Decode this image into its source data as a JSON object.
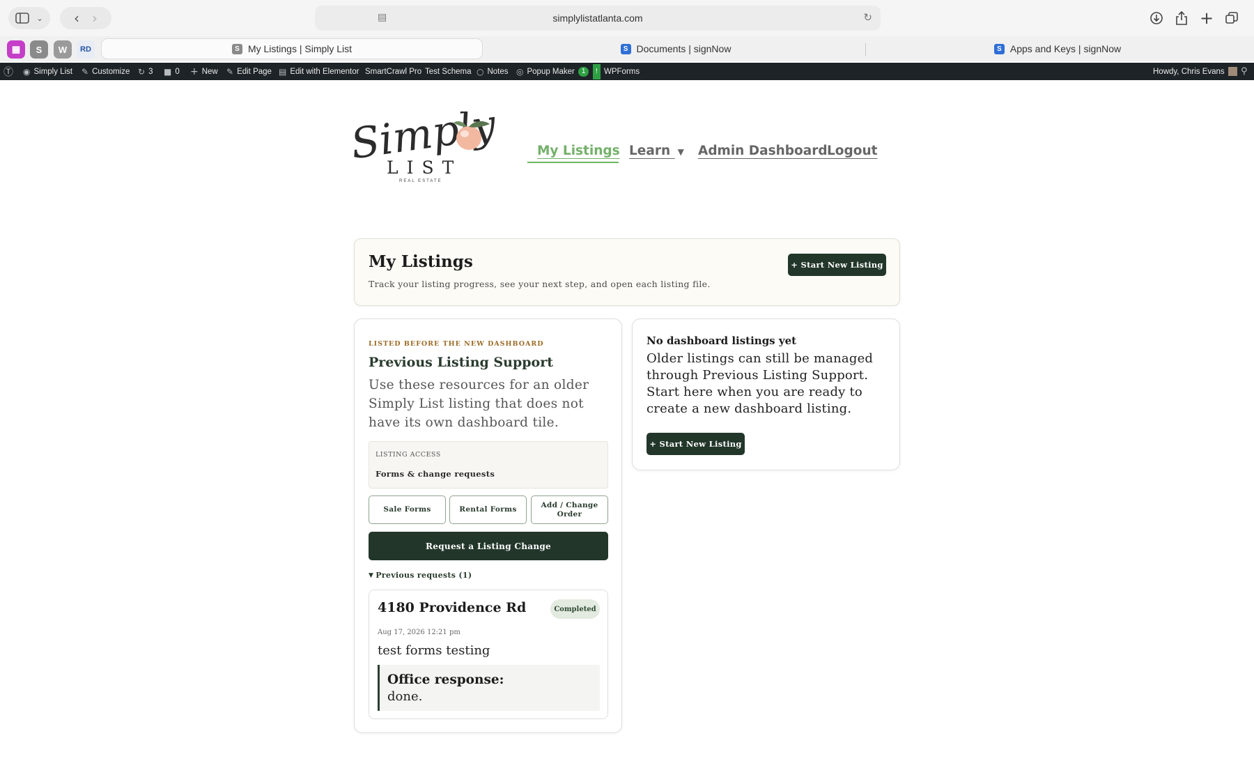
{
  "browser": {
    "url": "simplylistatlanta.com",
    "pinned_tabs": [
      "S",
      "W",
      "RD"
    ],
    "tabs": [
      {
        "title": "My Listings | Simply List",
        "active": true
      },
      {
        "title": "Documents | signNow",
        "active": false
      },
      {
        "title": "Apps and Keys | signNow",
        "active": false
      }
    ]
  },
  "admin_bar": {
    "site_name": "Simply List",
    "customize": "Customize",
    "updates_count": "3",
    "comments_count": "0",
    "new": "New",
    "edit_page": "Edit Page",
    "edit_elementor": "Edit with Elementor",
    "smartcrawl": "SmartCrawl Pro",
    "test_schema": "Test Schema",
    "notes": "Notes",
    "popup_maker": "Popup Maker",
    "popup_count": "1",
    "alert": "!",
    "wpforms": "WPForms",
    "howdy": "Howdy, Chris Evans"
  },
  "logo": {
    "script": "Simply",
    "word": "LIST",
    "tagline": "REAL ESTATE"
  },
  "nav": {
    "items": [
      {
        "label": "My Listings",
        "active": true
      },
      {
        "label": "Learn",
        "active": false
      },
      {
        "label": "Admin Dashboard",
        "active": false
      },
      {
        "label": "Logout",
        "active": false
      }
    ]
  },
  "hero": {
    "title": "My Listings",
    "subtitle": "Track your listing progress, see your next step, and open each listing file.",
    "button": "+ Start New Listing"
  },
  "support": {
    "eyebrow": "LISTED BEFORE THE NEW DASHBOARD",
    "title": "Previous Listing Support",
    "description": "Use these resources for an older Simply List listing that does not have its own dashboard tile.",
    "access_label": "LISTING ACCESS",
    "access_value": "Forms & change requests",
    "buttons": [
      "Sale Forms",
      "Rental Forms",
      "Add / Change Order"
    ],
    "request_button": "Request a Listing Change",
    "previous_toggle": "Previous requests (1)",
    "request": {
      "address": "4180 Providence Rd",
      "status": "Completed",
      "date": "Aug 17, 2026 12:21 pm",
      "message": "test forms testing",
      "office_label": "Office response:",
      "office_text": "done."
    }
  },
  "empty": {
    "title": "No dashboard listings yet",
    "description": "Older listings can still be managed through Previous Listing Support. Start here when you are ready to create a new dashboard listing.",
    "button": "+ Start New Listing"
  },
  "colors": {
    "accent_green": "#74b06a",
    "dark_green": "#22362a",
    "eyebrow_gold": "#9a6a24",
    "admin_bar": "#1d2327"
  }
}
